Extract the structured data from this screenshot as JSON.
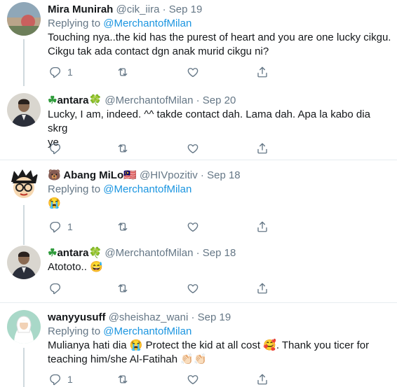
{
  "tweets": [
    {
      "name": "Mira Munirah",
      "handle": "@cik_iira",
      "dot": "·",
      "date": "Sep 19",
      "reply_prefix": "Replying to ",
      "reply_to": "@MerchantofMilan",
      "line1": "Touching nya..the kid has the purest of heart and you are one lucky cikgu.",
      "line2": "Cikgu tak ada contact dgn anak murid cikgu ni?",
      "reply_count": "1"
    },
    {
      "name_prefix": "☘",
      "name": "antara",
      "name_suffix": "🍀",
      "handle": "@MerchantofMilan",
      "dot": "·",
      "date": "Sep 20",
      "line1": "Lucky, I am, indeed. ^^ takde contact dah. Lama dah. Apa la kabo dia skrg",
      "line2": "ye",
      "reply_count": ""
    },
    {
      "name_prefix": "🐻",
      "name": "Abang MiLo",
      "name_suffix": "🇲🇾",
      "handle": "@HIVpozitiv",
      "dot": "·",
      "date": "Sep 18",
      "reply_prefix": "Replying to ",
      "reply_to": "@MerchantofMilan",
      "line1": "😭",
      "reply_count": "1"
    },
    {
      "name_prefix": "☘",
      "name": "antara",
      "name_suffix": "🍀",
      "handle": "@MerchantofMilan",
      "dot": "·",
      "date": "Sep 18",
      "line1": "Atototo.. 😅",
      "reply_count": ""
    },
    {
      "name": "wanyyusuff",
      "handle": "@sheishaz_wani",
      "dot": "·",
      "date": "Sep 19",
      "reply_prefix": "Replying to ",
      "reply_to": "@MerchantofMilan",
      "line1": "Mulianya hati dia 😭 Protect the kid at all cost 🥰. Thank you ticer for",
      "line2": "teaching him/she Al-Fatihah 👏🏻👏🏻",
      "reply_count": "1"
    }
  ],
  "icons": {
    "reply": "reply-icon",
    "retweet": "retweet-icon",
    "like": "heart-icon",
    "share": "share-icon"
  },
  "colors": {
    "link": "#1b95e0",
    "muted": "#657786",
    "divider": "#e6ecf0"
  }
}
